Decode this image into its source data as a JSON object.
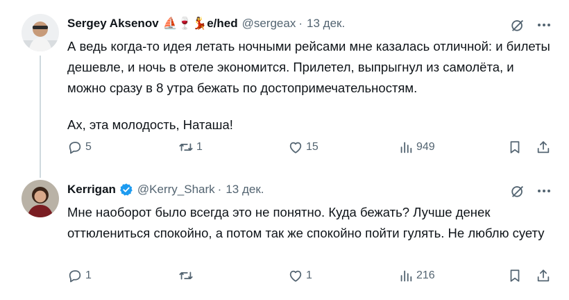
{
  "tweets": [
    {
      "name": "Sergey Aksenov",
      "name_emojis": "⛵🍷💃",
      "name_suffix": "e/hed",
      "handle": "@sergeax",
      "separator": "·",
      "date": "13 дек.",
      "text_p1": "А ведь когда-то идея летать ночными рейсами мне казалась отличной: и билеты дешевле, и ночь в отеле экономится. Прилетел, выпрыгнул из самолёта, и можно сразу в 8 утра бежать по достопримечательностям.",
      "text_p2": "Ах, эта молодость, Наташа!",
      "replies": "5",
      "reposts": "1",
      "likes": "15",
      "views": "949"
    },
    {
      "name": "Kerrigan",
      "handle": "@Kerry_Shark",
      "separator": "·",
      "date": "13 дек.",
      "text_p1": "Мне наоборот было всегда это не понятно. Куда бежать? Лучше денек оттюлениться спокойно, а потом так же спокойно пойти гулять. Не люблю суету",
      "replies": "1",
      "reposts": "",
      "likes": "1",
      "views": "216"
    }
  ],
  "colors": {
    "text": "#0f1419",
    "muted": "#536471",
    "verified": "#1d9bf0",
    "line": "#cfd9de"
  }
}
